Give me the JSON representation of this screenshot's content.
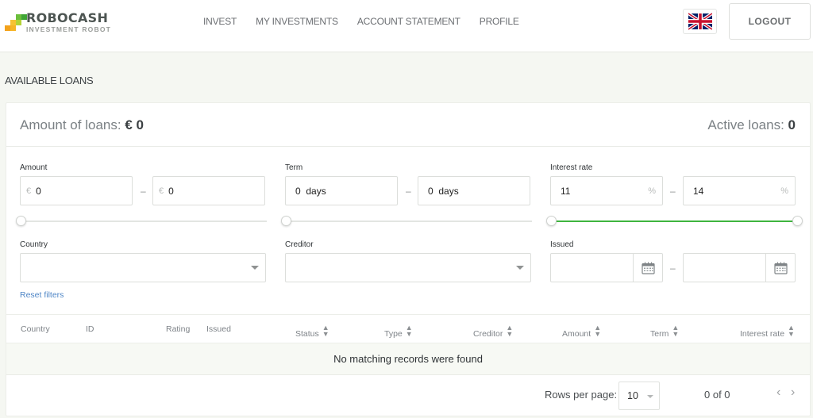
{
  "header": {
    "logo": {
      "title": "ROBOCASH",
      "subtitle": "INVESTMENT ROBOT",
      "colors": [
        "#f3a21b",
        "#f7c234",
        "#b3d335",
        "#6cbf3c",
        "#3fa535"
      ]
    },
    "nav": [
      {
        "label": "INVEST"
      },
      {
        "label": "MY INVESTMENTS"
      },
      {
        "label": "ACCOUNT STATEMENT"
      },
      {
        "label": "PROFILE"
      }
    ],
    "language_icon": "uk-flag-icon",
    "logout_label": "LOGOUT"
  },
  "page": {
    "title": "AVAILABLE LOANS"
  },
  "summary": {
    "amount_label": "Amount of loans:",
    "amount_value": "€ 0",
    "active_label": "Active loans:",
    "active_value": "0"
  },
  "filters": {
    "amount": {
      "label": "Amount",
      "currency_symbol": "€",
      "from": "0",
      "to": "0",
      "slider_fraction": [
        0,
        0
      ]
    },
    "term": {
      "label": "Term",
      "from": "0  days",
      "to": "0  days",
      "slider_fraction": [
        0,
        0
      ]
    },
    "interest_rate": {
      "label": "Interest rate",
      "from": "11",
      "to": "14",
      "unit": "%",
      "slider_fraction": [
        0,
        1
      ]
    },
    "country": {
      "label": "Country",
      "value": ""
    },
    "creditor": {
      "label": "Creditor",
      "value": ""
    },
    "issued": {
      "label": "Issued",
      "from": "",
      "to": ""
    },
    "range_separator": "–",
    "reset_label": "Reset filters"
  },
  "table": {
    "columns": [
      {
        "label": "Country",
        "sortable": false
      },
      {
        "label": "ID",
        "sortable": false
      },
      {
        "label": "Rating",
        "sortable": false
      },
      {
        "label": "Issued",
        "sortable": false
      },
      {
        "label": "Status",
        "sortable": true
      },
      {
        "label": "Type",
        "sortable": true
      },
      {
        "label": "Creditor",
        "sortable": true
      },
      {
        "label": "Amount",
        "sortable": true
      },
      {
        "label": "Term",
        "sortable": true
      },
      {
        "label": "Interest rate",
        "sortable": true
      }
    ],
    "empty_message": "No matching records were found"
  },
  "pagination": {
    "rows_label": "Rows per page:",
    "rows_value": "10",
    "page_info": "0 of 0",
    "prev_icon": "‹",
    "next_icon": "›"
  },
  "colors": {
    "accent_green": "#3fb53f",
    "link_blue": "#4f86c6",
    "page_bg": "#f5f7f2"
  }
}
